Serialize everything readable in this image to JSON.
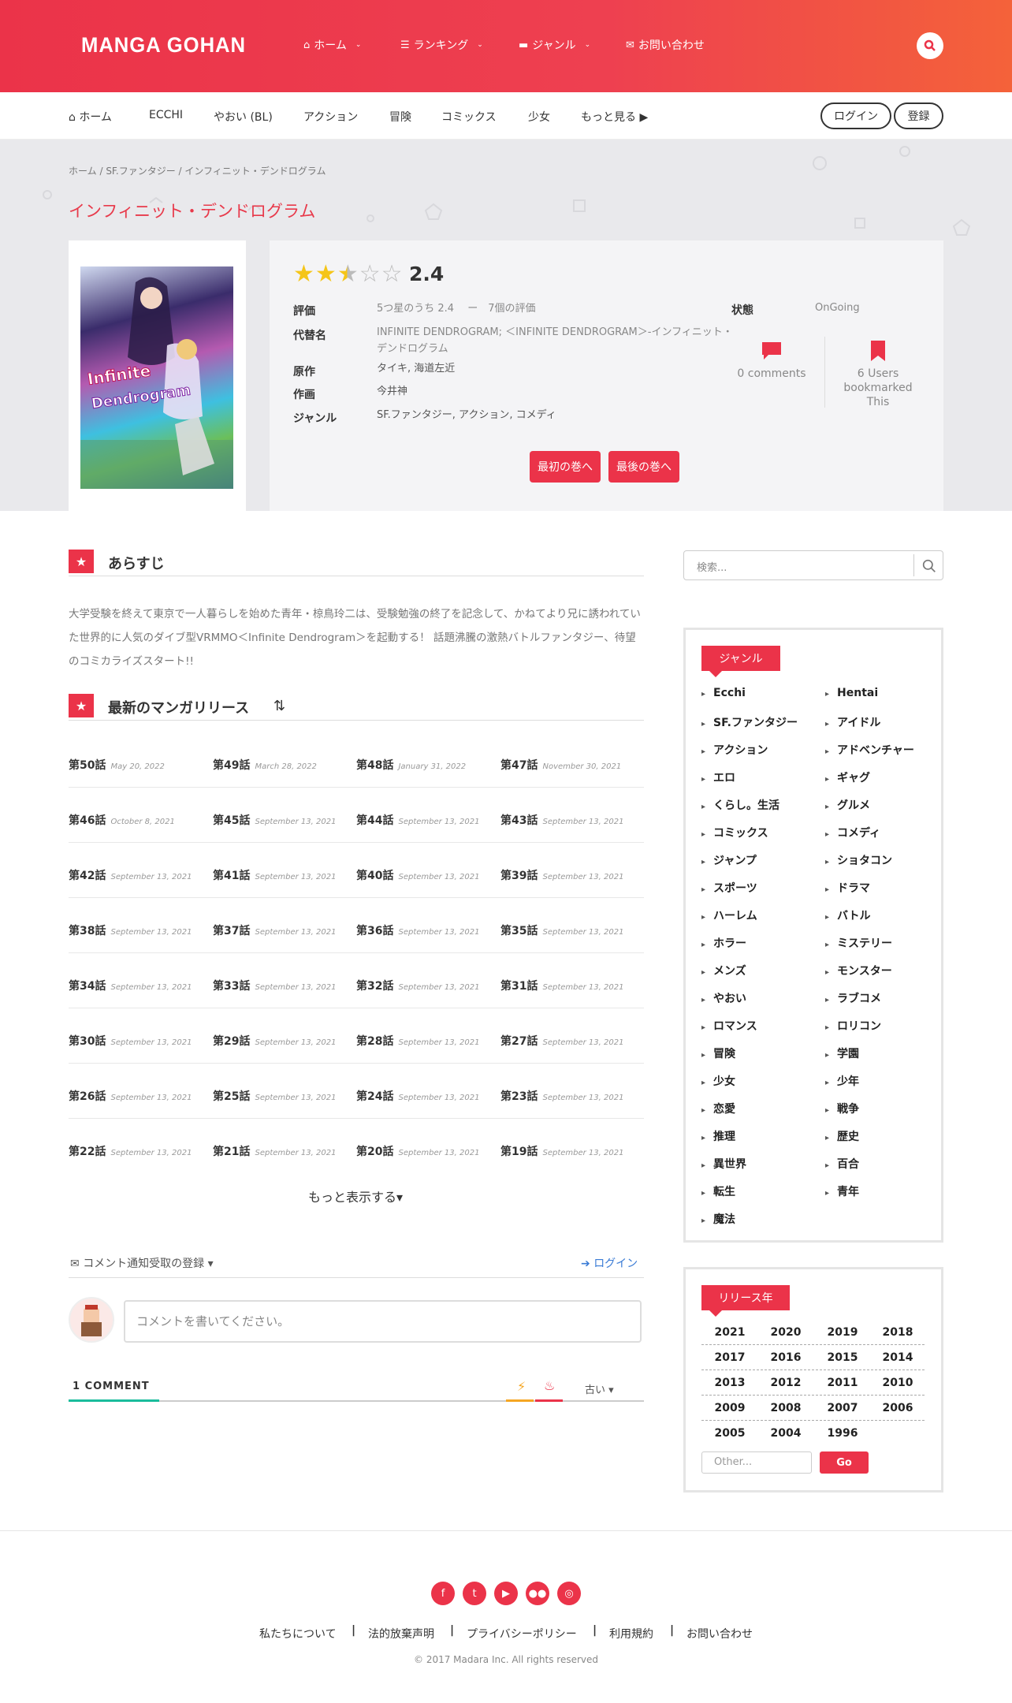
{
  "header": {
    "logo": "MANGA GOHAN",
    "nav": [
      {
        "label": "ホーム",
        "icon": "home-icon"
      },
      {
        "label": "ランキング",
        "icon": "list-icon"
      },
      {
        "label": "ジャンル",
        "icon": "folder-icon"
      },
      {
        "label": "お問い合わせ",
        "icon": "mail-icon"
      }
    ]
  },
  "subnav": {
    "items": [
      "ホーム",
      "ECCHI",
      "やおい (BL)",
      "アクション",
      "冒険",
      "コミックス",
      "少女",
      "もっと見る"
    ],
    "login": "ログイン",
    "register": "登録"
  },
  "breadcrumb": [
    "ホーム",
    "SF.ファンタジー",
    "インフィニット・デンドログラム"
  ],
  "title": "インフィニット・デンドログラム",
  "rating": {
    "value": "2.4",
    "stars": 2.4,
    "max": 5
  },
  "info": {
    "labels": {
      "rating": "評価",
      "alt": "代替名",
      "author": "原作",
      "artist": "作画",
      "genre": "ジャンル",
      "status": "状態"
    },
    "rating_text": "5つ星のうち 2.4 　ー　7個の評価",
    "alt_line1": "INFINITE DENDROGRAM; ＜INFINITE DENDROGRAM＞-インフィニット・",
    "alt_line2": "デンドログラム",
    "author": "タイキ, 海道左近",
    "artist": "今井神",
    "genre": "SF.ファンタジー, アクション, コメディ",
    "status": "OnGoing"
  },
  "stats": {
    "comments": "0 comments",
    "bookmarks_1": "6 Users",
    "bookmarks_2": "bookmarked",
    "bookmarks_3": "This"
  },
  "buttons": {
    "first": "最初の巻へ",
    "last": "最後の巻へ"
  },
  "synopsis_title": "あらすじ",
  "synopsis": "大学受験を終えて東京で一人暮らしを始めた青年・椋鳥玲二は、受験勉強の終了を記念して、かねてより兄に誘われていた世界的に人気のダイブ型VRMMO＜Infinite Dendrogram＞を起動する！ 話題沸騰の激熱バトルファンタジー、待望のコミカライズスタート!!",
  "releases_title": "最新のマンガリリース",
  "chapters": [
    {
      "name": "第50話",
      "date": "May 20, 2022"
    },
    {
      "name": "第49話",
      "date": "March 28, 2022"
    },
    {
      "name": "第48話",
      "date": "January 31, 2022"
    },
    {
      "name": "第47話",
      "date": "November 30, 2021"
    },
    {
      "name": "第46話",
      "date": "October 8, 2021"
    },
    {
      "name": "第45話",
      "date": "September 13, 2021"
    },
    {
      "name": "第44話",
      "date": "September 13, 2021"
    },
    {
      "name": "第43話",
      "date": "September 13, 2021"
    },
    {
      "name": "第42話",
      "date": "September 13, 2021"
    },
    {
      "name": "第41話",
      "date": "September 13, 2021"
    },
    {
      "name": "第40話",
      "date": "September 13, 2021"
    },
    {
      "name": "第39話",
      "date": "September 13, 2021"
    },
    {
      "name": "第38話",
      "date": "September 13, 2021"
    },
    {
      "name": "第37話",
      "date": "September 13, 2021"
    },
    {
      "name": "第36話",
      "date": "September 13, 2021"
    },
    {
      "name": "第35話",
      "date": "September 13, 2021"
    },
    {
      "name": "第34話",
      "date": "September 13, 2021"
    },
    {
      "name": "第33話",
      "date": "September 13, 2021"
    },
    {
      "name": "第32話",
      "date": "September 13, 2021"
    },
    {
      "name": "第31話",
      "date": "September 13, 2021"
    },
    {
      "name": "第30話",
      "date": "September 13, 2021"
    },
    {
      "name": "第29話",
      "date": "September 13, 2021"
    },
    {
      "name": "第28話",
      "date": "September 13, 2021"
    },
    {
      "name": "第27話",
      "date": "September 13, 2021"
    },
    {
      "name": "第26話",
      "date": "September 13, 2021"
    },
    {
      "name": "第25話",
      "date": "September 13, 2021"
    },
    {
      "name": "第24話",
      "date": "September 13, 2021"
    },
    {
      "name": "第23話",
      "date": "September 13, 2021"
    },
    {
      "name": "第22話",
      "date": "September 13, 2021"
    },
    {
      "name": "第21話",
      "date": "September 13, 2021"
    },
    {
      "name": "第20話",
      "date": "September 13, 2021"
    },
    {
      "name": "第19話",
      "date": "September 13, 2021"
    }
  ],
  "show_more": "もっと表示する",
  "comments": {
    "subscribe": "コメント通知受取の登録",
    "login": "ログイン",
    "placeholder": "コメントを書いてください。",
    "count": "1 COMMENT",
    "sort": "古い"
  },
  "sidebar": {
    "search_placeholder": "検索...",
    "genre_title": "ジャンル",
    "genres": [
      "Ecchi",
      "Hentai",
      "SF.ファンタジー",
      "アイドル",
      "アクション",
      "アドベンチャー",
      "エロ",
      "ギャグ",
      "くらし。生活",
      "グルメ",
      "コミックス",
      "コメディ",
      "ジャンプ",
      "ショタコン",
      "スポーツ",
      "ドラマ",
      "ハーレム",
      "バトル",
      "ホラー",
      "ミステリー",
      "メンズ",
      "モンスター",
      "やおい",
      "ラブコメ",
      "ロマンス",
      "ロリコン",
      "冒険",
      "学園",
      "少女",
      "少年",
      "恋愛",
      "戦争",
      "推理",
      "歴史",
      "異世界",
      "百合",
      "転生",
      "青年",
      "魔法"
    ],
    "year_title": "リリース年",
    "years": [
      "2021",
      "2020",
      "2019",
      "2018",
      "2017",
      "2016",
      "2015",
      "2014",
      "2013",
      "2012",
      "2011",
      "2010",
      "2009",
      "2008",
      "2007",
      "2006",
      "2005",
      "2004",
      "1996"
    ],
    "other_placeholder": "Other...",
    "go": "Go"
  },
  "footer": {
    "links": [
      "私たちについて",
      "法的放棄声明",
      "プライバシーポリシー",
      "利用規約",
      "お問い合わせ"
    ],
    "copyright": "© 2017 Madara Inc. All rights reserved",
    "social": [
      "facebook-icon",
      "twitter-icon",
      "youtube-icon",
      "flickr-icon",
      "instagram-icon"
    ]
  },
  "colors": {
    "accent": "#eb3349",
    "accent2": "#f4623a",
    "star": "#f5c518"
  }
}
